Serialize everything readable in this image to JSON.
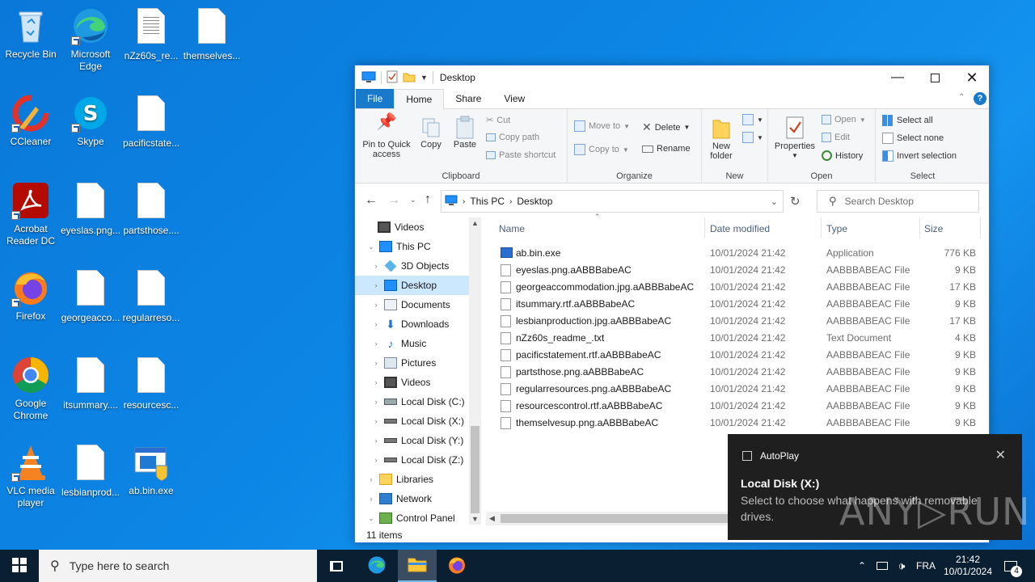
{
  "desktop": {
    "icons": [
      {
        "label": "Recycle Bin"
      },
      {
        "label": "Microsoft Edge"
      },
      {
        "label": "nZz60s_re..."
      },
      {
        "label": "themselves..."
      },
      {
        "label": "CCleaner"
      },
      {
        "label": "Skype"
      },
      {
        "label": "pacificstate..."
      },
      {
        "label": "Acrobat Reader DC"
      },
      {
        "label": "eyeslas.png..."
      },
      {
        "label": "partsthose...."
      },
      {
        "label": "Firefox"
      },
      {
        "label": "georgeacco..."
      },
      {
        "label": "regularreso..."
      },
      {
        "label": "Google Chrome"
      },
      {
        "label": "itsummary...."
      },
      {
        "label": "resourcesc..."
      },
      {
        "label": "VLC media player"
      },
      {
        "label": "lesbianprod..."
      },
      {
        "label": "ab.bin.exe"
      }
    ]
  },
  "window": {
    "title": "Desktop",
    "tabs": {
      "file": "File",
      "home": "Home",
      "share": "Share",
      "view": "View"
    },
    "ribbon": {
      "clipboard": {
        "pin": "Pin to Quick access",
        "copy": "Copy",
        "paste": "Paste",
        "cut": "Cut",
        "copy_path": "Copy path",
        "paste_shortcut": "Paste shortcut",
        "label": "Clipboard"
      },
      "organize": {
        "move_to": "Move to",
        "copy_to": "Copy to",
        "delete": "Delete",
        "rename": "Rename",
        "label": "Organize"
      },
      "new": {
        "new_folder": "New folder",
        "label": "New"
      },
      "open": {
        "properties": "Properties",
        "open": "Open",
        "edit": "Edit",
        "history": "History",
        "label": "Open"
      },
      "select": {
        "select_all": "Select all",
        "select_none": "Select none",
        "invert": "Invert selection",
        "label": "Select"
      }
    },
    "address": {
      "this_pc": "This PC",
      "desktop": "Desktop"
    },
    "search_placeholder": "Search Desktop",
    "nav": [
      {
        "label": "Videos"
      },
      {
        "label": "This PC"
      },
      {
        "label": "3D Objects"
      },
      {
        "label": "Desktop"
      },
      {
        "label": "Documents"
      },
      {
        "label": "Downloads"
      },
      {
        "label": "Music"
      },
      {
        "label": "Pictures"
      },
      {
        "label": "Videos"
      },
      {
        "label": "Local Disk (C:)"
      },
      {
        "label": "Local Disk (X:)"
      },
      {
        "label": "Local Disk (Y:)"
      },
      {
        "label": "Local Disk (Z:)"
      },
      {
        "label": "Libraries"
      },
      {
        "label": "Network"
      },
      {
        "label": "Control Panel"
      }
    ],
    "columns": {
      "name": "Name",
      "date": "Date modified",
      "type": "Type",
      "size": "Size"
    },
    "files": [
      {
        "name": "ab.bin.exe",
        "date": "10/01/2024 21:42",
        "type": "Application",
        "size": "776 KB"
      },
      {
        "name": "eyeslas.png.aABBBabeAC",
        "date": "10/01/2024 21:42",
        "type": "AABBBABEAC File",
        "size": "9 KB"
      },
      {
        "name": "georgeaccommodation.jpg.aABBBabeAC",
        "date": "10/01/2024 21:42",
        "type": "AABBBABEAC File",
        "size": "17 KB"
      },
      {
        "name": "itsummary.rtf.aABBBabeAC",
        "date": "10/01/2024 21:42",
        "type": "AABBBABEAC File",
        "size": "9 KB"
      },
      {
        "name": "lesbianproduction.jpg.aABBBabeAC",
        "date": "10/01/2024 21:42",
        "type": "AABBBABEAC File",
        "size": "17 KB"
      },
      {
        "name": "nZz60s_readme_.txt",
        "date": "10/01/2024 21:42",
        "type": "Text Document",
        "size": "4 KB"
      },
      {
        "name": "pacificstatement.rtf.aABBBabeAC",
        "date": "10/01/2024 21:42",
        "type": "AABBBABEAC File",
        "size": "9 KB"
      },
      {
        "name": "partsthose.png.aABBBabeAC",
        "date": "10/01/2024 21:42",
        "type": "AABBBABEAC File",
        "size": "9 KB"
      },
      {
        "name": "regularresources.png.aABBBabeAC",
        "date": "10/01/2024 21:42",
        "type": "AABBBABEAC File",
        "size": "9 KB"
      },
      {
        "name": "resourcescontrol.rtf.aABBBabeAC",
        "date": "10/01/2024 21:42",
        "type": "AABBBABEAC File",
        "size": "9 KB"
      },
      {
        "name": "themselvesup.png.aABBBabeAC",
        "date": "10/01/2024 21:42",
        "type": "AABBBABEAC File",
        "size": "9 KB"
      }
    ],
    "status": "11 items"
  },
  "toast": {
    "app": "AutoPlay",
    "title": "Local Disk (X:)",
    "body": "Select to choose what happens with removable drives."
  },
  "watermark": "ANY▷RUN",
  "taskbar": {
    "search_placeholder": "Type here to search",
    "language": "FRA",
    "time": "21:42",
    "date": "10/01/2024",
    "notification_count": "4"
  }
}
